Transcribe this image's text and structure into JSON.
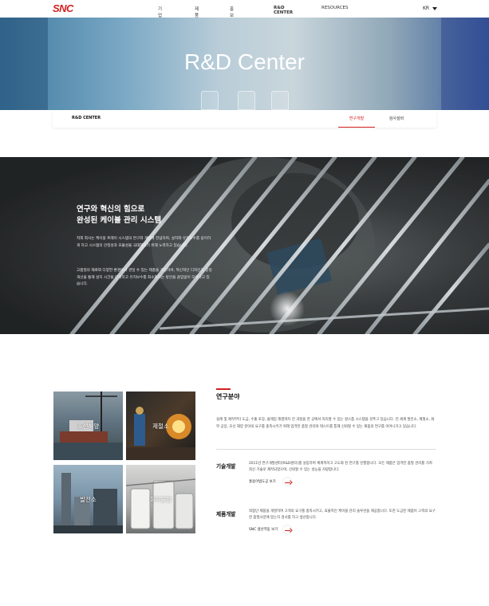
{
  "header": {
    "logo": "SNC",
    "nav": [
      "기업소개",
      "제품안내",
      "홍보미디어",
      "R&D CENTER",
      "RESOURCES"
    ],
    "lang": "KR"
  },
  "hero": {
    "title": "R&D Center"
  },
  "subnav": {
    "section": "R&D CENTER",
    "tabs": [
      "연구개발",
      "검사설비"
    ]
  },
  "feature": {
    "title_line1": "연구와 혁신의 힘으로",
    "title_line2": "완성된 케이블 관리 시스템",
    "para1": "저희 회사는 케이블 트레이 시스템의 연구와 개발에 전념하며, 설치와 유지보수를 용이하게 하고 시스템의 안정성과 효율성을 극대화하기 위해 노력하고 있습니다.",
    "para2": "고품질의 재료와 다양한 환경에서 견딜 수 있는 제품을 개발하며, 혁신적인 디자인과 공정 개선을 통해 설치 시간을 단축하고 유지보수를 최소화하는 방안을 끊임없이 모색하고 있습니다."
  },
  "tiles": [
    "조선해양",
    "제철소",
    "발전소",
    "화학공장"
  ],
  "research": {
    "title": "연구분야",
    "description": "설계 및 제작부터 도금, 수출 포장, 클레임 해결까지 전 과정을 한 곳에서 처리할 수 있는 원스톱 시스템을 갖추고 있습니다. 전 세계 발전소, 제철소, 화학 공장, 조선 해양 분야의 요구를 충족시키기 위해 엄격한 품질 관리와 테스트를 통해 신뢰할 수 있는 제품의 연구를 이어나가고 있습니다.",
    "tech": {
      "heading": "기술개발",
      "text": "2011년 연구개발센터(R&D센터)를 설립하여 체계적이고 고도화 된 연구를 진행합니다. 모든 제품은 엄격한 품질 관리를 거쳐 최신 기술로 제작되었으며, 신뢰할 수 있는 성능을 자랑합니다.",
      "link": "홍용어법도공 보기"
    },
    "product": {
      "heading": "제품개발",
      "text": "최첨단 제품을 개발하여 고객의 요구를 충족시키고, 효율적인 케이블 관리 솔루션을 제공합니다. 또한 도금된 제품이 고객의 요구한 품질사양에 맞는지 검사를 하고 생산합니다.",
      "link": "SNC 생산역동 보기"
    }
  }
}
